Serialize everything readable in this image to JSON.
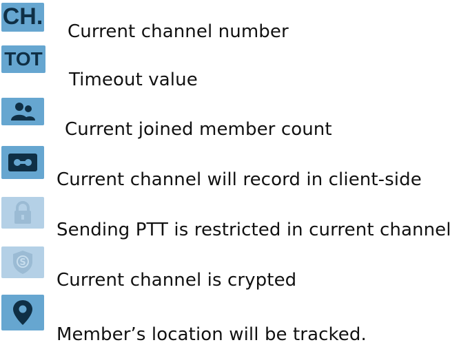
{
  "legend": {
    "items": [
      {
        "icon": "channel-number-icon",
        "icon_text": "CH.",
        "label": "Current channel number"
      },
      {
        "icon": "timeout-icon",
        "icon_text": "TOT",
        "label": "Timeout value"
      },
      {
        "icon": "members-icon",
        "label": "Current joined member count"
      },
      {
        "icon": "record-icon",
        "label": "Current channel will record in client-side"
      },
      {
        "icon": "lock-icon",
        "label": "Sending PTT is restricted in current channel"
      },
      {
        "icon": "shield-icon",
        "label": "Current channel is crypted"
      },
      {
        "icon": "location-pin-icon",
        "label": "Member’s location will be tracked."
      }
    ]
  },
  "colors": {
    "icon_blue": "#66a6d0",
    "icon_pale_blue": "#9fc4df",
    "glyph_dark": "#0f2f45"
  }
}
